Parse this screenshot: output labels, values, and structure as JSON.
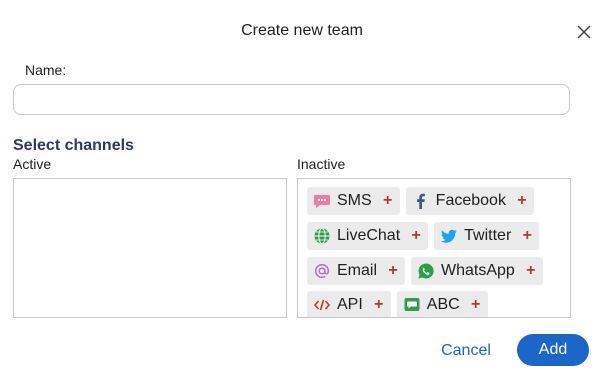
{
  "dialog": {
    "title": "Create new team",
    "close_icon": "close-icon"
  },
  "form": {
    "name_label": "Name:",
    "name_value": "",
    "name_placeholder": ""
  },
  "channels": {
    "section_title": "Select channels",
    "active_label": "Active",
    "inactive_label": "Inactive",
    "active_items": [],
    "inactive_items": [
      {
        "label": "SMS",
        "icon": "sms-icon",
        "color": "#f07ca2"
      },
      {
        "label": "Facebook",
        "icon": "facebook-icon",
        "color": "#3b5998"
      },
      {
        "label": "LiveChat",
        "icon": "globe-icon",
        "color": "#2e9e4f"
      },
      {
        "label": "Twitter",
        "icon": "twitter-icon",
        "color": "#1da1f2"
      },
      {
        "label": "Email",
        "icon": "at-icon",
        "color": "#b070c8"
      },
      {
        "label": "WhatsApp",
        "icon": "whatsapp-icon",
        "color": "#25a244"
      },
      {
        "label": "API",
        "icon": "code-icon",
        "color": "#c0392b"
      },
      {
        "label": "ABC",
        "icon": "chat-bubble-icon",
        "color": "#2e9e4f"
      }
    ],
    "add_symbol": "+"
  },
  "actions": {
    "cancel_label": "Cancel",
    "add_label": "Add",
    "accent_color": "#1b66c9"
  }
}
